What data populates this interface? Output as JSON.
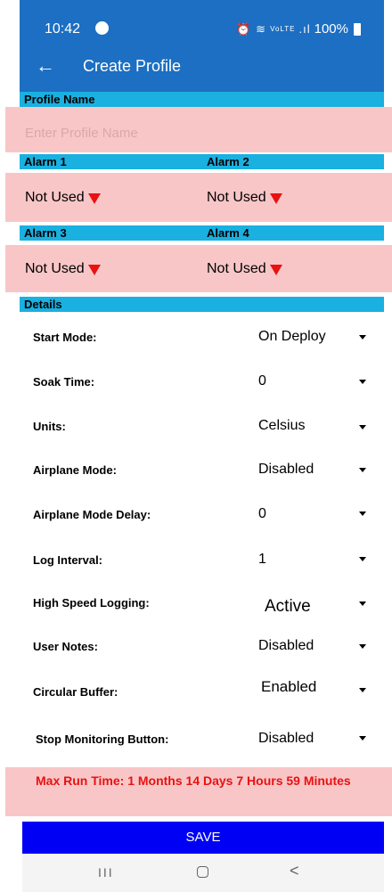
{
  "status_bar": {
    "time": "10:42",
    "network": "VoLTE",
    "battery": "100%"
  },
  "header": {
    "title": "Create Profile"
  },
  "profile_name": {
    "section_label": "Profile Name",
    "placeholder": "Enter Profile Name"
  },
  "alarms": {
    "alarm1_label": "Alarm 1",
    "alarm2_label": "Alarm 2",
    "alarm3_label": "Alarm 3",
    "alarm4_label": "Alarm 4",
    "alarm1_value": "Not Used",
    "alarm2_value": "Not Used",
    "alarm3_value": "Not Used",
    "alarm4_value": "Not Used"
  },
  "details": {
    "section_label": "Details",
    "start_mode": {
      "label": "Start Mode:",
      "value": "On Deploy"
    },
    "soak_time": {
      "label": "Soak Time:",
      "value": "0"
    },
    "units": {
      "label": "Units:",
      "value": "Celsius"
    },
    "airplane_mode": {
      "label": "Airplane Mode:",
      "value": "Disabled"
    },
    "airplane_mode_delay": {
      "label": "Airplane Mode Delay:",
      "value": "0"
    },
    "log_interval": {
      "label": "Log Interval:",
      "value": "1"
    },
    "high_speed_logging": {
      "label": "High Speed Logging:",
      "value": "Active"
    },
    "user_notes": {
      "label": "User Notes:",
      "value": "Disabled"
    },
    "circular_buffer": {
      "label": "Circular Buffer:",
      "value": "Enabled"
    },
    "stop_monitoring_button": {
      "label": "Stop Monitoring Button:",
      "value": "Disabled"
    }
  },
  "max_run_time": "Max Run Time: 1 Months 14 Days 7 Hours 59 Minutes",
  "save_label": "SAVE",
  "nav": {
    "recent_icon": "III",
    "back_icon": "<"
  },
  "colors": {
    "app_bar": "#1c6fc2",
    "section_bar": "#1ab0e0",
    "highlight_pink": "#f9c6c7",
    "warning_red": "#e81212",
    "save_button": "#0000f5"
  }
}
